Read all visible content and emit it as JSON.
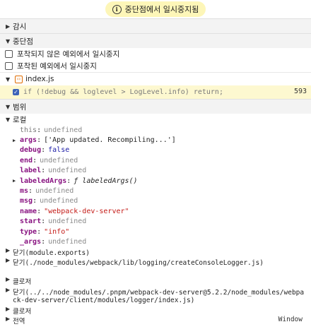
{
  "pause": {
    "label": "중단점에서 일시중지됨",
    "icon": "info-icon"
  },
  "sections": {
    "watch": "감시",
    "breakpoints": "중단점",
    "scope": "범위"
  },
  "exceptions": [
    {
      "label": "포착되지 않은 예외에서 일시중지"
    },
    {
      "label": "포착된 예외에서 일시중지"
    }
  ],
  "breakpoint": {
    "file": "index.js",
    "code": "if (!debug && loglevel > LogLevel.info) return;",
    "line": "593"
  },
  "scope": {
    "local_label": "로컬",
    "props": [
      {
        "key": "this",
        "value": "undefined",
        "kind": "undef",
        "dim": true,
        "expandable": false
      },
      {
        "key": "args",
        "value": "['App updated. Recompiling...']",
        "kind": "plain",
        "dim": false,
        "expandable": true
      },
      {
        "key": "debug",
        "value": "false",
        "kind": "bool",
        "dim": false,
        "expandable": false
      },
      {
        "key": "end",
        "value": "undefined",
        "kind": "undef",
        "dim": false,
        "expandable": false
      },
      {
        "key": "label",
        "value": "undefined",
        "kind": "undef",
        "dim": false,
        "expandable": false
      },
      {
        "key": "labeledArgs",
        "value": "ƒ labeledArgs()",
        "kind": "fn",
        "dim": false,
        "expandable": true
      },
      {
        "key": "ms",
        "value": "undefined",
        "kind": "undef",
        "dim": false,
        "expandable": false
      },
      {
        "key": "msg",
        "value": "undefined",
        "kind": "undef",
        "dim": false,
        "expandable": false
      },
      {
        "key": "name",
        "value": "\"webpack-dev-server\"",
        "kind": "str",
        "dim": false,
        "expandable": false
      },
      {
        "key": "start",
        "value": "undefined",
        "kind": "undef",
        "dim": false,
        "expandable": false
      },
      {
        "key": "type",
        "value": "\"info\"",
        "kind": "str",
        "dim": false,
        "expandable": false
      },
      {
        "key": "_args",
        "value": "undefined",
        "kind": "undef",
        "dim": false,
        "expandable": false
      }
    ],
    "closures": [
      "닫기(module.exports)",
      "닫기(./node_modules/webpack/lib/logging/createConsoleLogger.js)",
      "클로저",
      "닫기(../../node_modules/.pnpm/webpack-dev-server@5.2.2/node_modules/webpack-dev-server/client/modules/logger/index.js)",
      "클로저"
    ],
    "global_label": "전역",
    "global_value": "Window"
  }
}
